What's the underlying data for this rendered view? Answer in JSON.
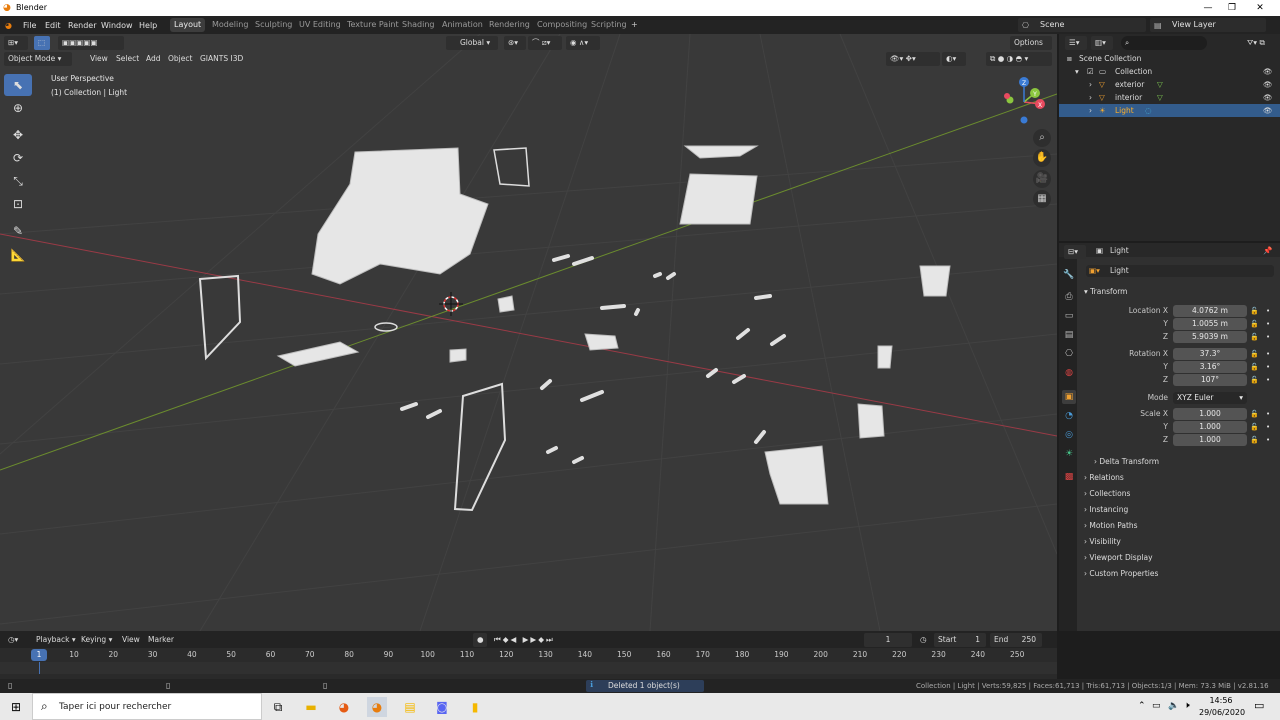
{
  "window": {
    "title": "Blender",
    "min": "—",
    "max": "❐",
    "close": "✕"
  },
  "menu": [
    "File",
    "Edit",
    "Render",
    "Window",
    "Help"
  ],
  "workspaces": [
    "Layout",
    "Modeling",
    "Sculpting",
    "UV Editing",
    "Texture Paint",
    "Shading",
    "Animation",
    "Rendering",
    "Compositing",
    "Scripting"
  ],
  "workspace_add": "+",
  "scene": "Scene",
  "view_layer": "View Layer",
  "viewport": {
    "mode": "Object Mode",
    "menu": [
      "View",
      "Select",
      "Add",
      "Object",
      "GIANTS I3D"
    ],
    "orientation": "Global",
    "options": "Options",
    "info_line1": "User Perspective",
    "info_line2": "(1) Collection | Light",
    "gizmo_x": "X",
    "gizmo_y": "Y",
    "gizmo_z": "Z"
  },
  "outliner": {
    "root": "Scene Collection",
    "collection": "Collection",
    "items": [
      "exterior",
      "interior",
      "Light"
    ]
  },
  "properties": {
    "object_name": "Light",
    "data_name": "Light",
    "transform": "Transform",
    "location_x_label": "Location X",
    "y_label": "Y",
    "z_label": "Z",
    "location": [
      "4.0762 m",
      "1.0055 m",
      "5.9039 m"
    ],
    "rotation_x_label": "Rotation X",
    "rotation": [
      "37.3°",
      "3.16°",
      "107°"
    ],
    "mode_label": "Mode",
    "mode": "XYZ Euler",
    "scale_x_label": "Scale X",
    "scale": [
      "1.000",
      "1.000",
      "1.000"
    ],
    "delta_transform": "Delta Transform",
    "sections": [
      "Relations",
      "Collections",
      "Instancing",
      "Motion Paths",
      "Visibility",
      "Viewport Display",
      "Custom Properties"
    ]
  },
  "timeline": {
    "menu": [
      "Playback",
      "Keying",
      "View",
      "Marker"
    ],
    "current_frame": "1",
    "start_label": "Start",
    "start": "1",
    "end_label": "End",
    "end": "250",
    "ruler": [
      "1",
      "10",
      "20",
      "30",
      "40",
      "50",
      "60",
      "70",
      "80",
      "90",
      "100",
      "110",
      "120",
      "130",
      "140",
      "150",
      "160",
      "170",
      "180",
      "190",
      "200",
      "210",
      "220",
      "230",
      "240",
      "250"
    ]
  },
  "status": {
    "message": "Deleted 1 object(s)",
    "stats": "Collection | Light | Verts:59,825 | Faces:61,713 | Tris:61,713 | Objects:1/3 | Mem: 73.3 MiB | v2.81.16"
  },
  "taskbar": {
    "search_placeholder": "Taper ici pour rechercher",
    "time": "14:56",
    "date": "29/06/2020"
  },
  "colors": {
    "accent": "#4772b3",
    "selected_row": "#335c8c",
    "x_axis": "#e84a5f",
    "y_axis": "#8cc63f",
    "z_axis": "#3a7bd5",
    "active_object": "#ffaf29"
  }
}
